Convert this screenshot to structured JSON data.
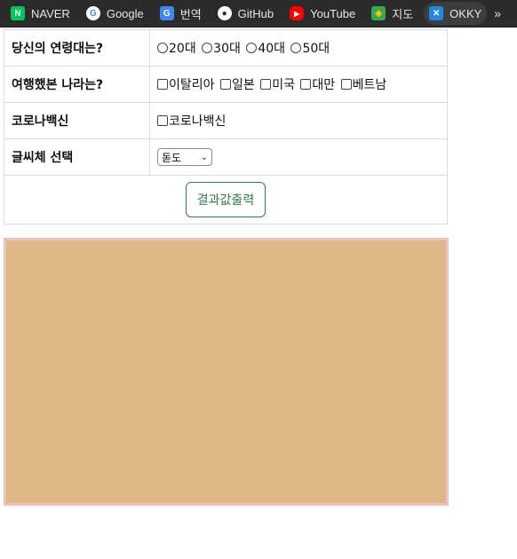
{
  "bookmarks": [
    {
      "label": "NAVER",
      "icon": "naver-icon",
      "color": "#03c75a",
      "glyph": "N"
    },
    {
      "label": "Google",
      "icon": "google-icon",
      "color": "#ffffff",
      "glyph": "G"
    },
    {
      "label": "번역",
      "icon": "translate-icon",
      "color": "#4285f4",
      "glyph": "G"
    },
    {
      "label": "GitHub",
      "icon": "github-icon",
      "color": "#ffffff",
      "glyph": "●"
    },
    {
      "label": "YouTube",
      "icon": "youtube-icon",
      "color": "#ff0000",
      "glyph": "▶"
    },
    {
      "label": "지도",
      "icon": "maps-icon",
      "color": "#34a853",
      "glyph": "◆"
    },
    {
      "label": "OKKY",
      "icon": "okky-icon",
      "color": "#1e88e5",
      "glyph": "✕"
    }
  ],
  "bookmarks_more": "»",
  "form": {
    "age": {
      "label": "당신의 연령대는?",
      "options": [
        "20대",
        "30대",
        "40대",
        "50대"
      ]
    },
    "countries": {
      "label": "여행했본 나라는?",
      "options": [
        "이탈리아",
        "일본",
        "미국",
        "대만",
        "베트남"
      ]
    },
    "vaccine": {
      "label": "코로나백신",
      "options": [
        "코로나백신"
      ]
    },
    "font": {
      "label": "글씨체 선택",
      "selected": "돋도"
    },
    "submit_label": "결과값출력"
  },
  "colors": {
    "result_bg": "#e0b686",
    "result_border": "#eec2c3",
    "button": "#2e7d4f"
  }
}
